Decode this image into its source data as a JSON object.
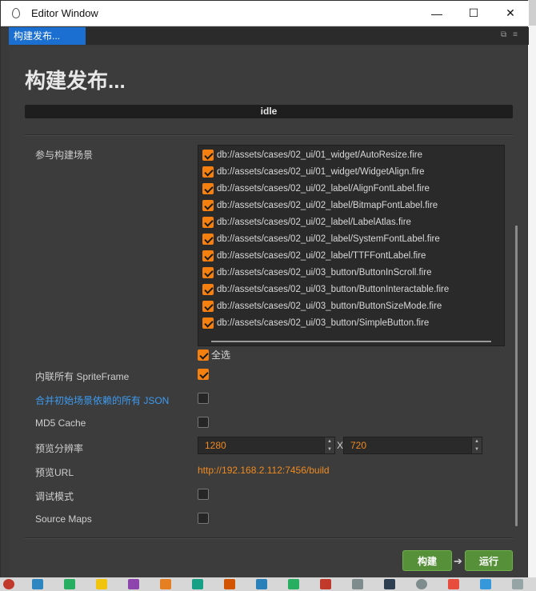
{
  "window": {
    "title": "Editor Window",
    "minimize": "—",
    "maximize": "☐",
    "close": "✕"
  },
  "tab": {
    "label": "构建发布..."
  },
  "heading": "构建发布...",
  "status": "idle",
  "scenes_label": "参与构建场景",
  "scenes": [
    {
      "path": "db://assets/cases/02_ui/01_widget/AutoResize.fire",
      "checked": true
    },
    {
      "path": "db://assets/cases/02_ui/01_widget/WidgetAlign.fire",
      "checked": true
    },
    {
      "path": "db://assets/cases/02_ui/02_label/AlignFontLabel.fire",
      "checked": true
    },
    {
      "path": "db://assets/cases/02_ui/02_label/BitmapFontLabel.fire",
      "checked": true
    },
    {
      "path": "db://assets/cases/02_ui/02_label/LabelAtlas.fire",
      "checked": true
    },
    {
      "path": "db://assets/cases/02_ui/02_label/SystemFontLabel.fire",
      "checked": true
    },
    {
      "path": "db://assets/cases/02_ui/02_label/TTFFontLabel.fire",
      "checked": true
    },
    {
      "path": "db://assets/cases/02_ui/03_button/ButtonInScroll.fire",
      "checked": true
    },
    {
      "path": "db://assets/cases/02_ui/03_button/ButtonInteractable.fire",
      "checked": true
    },
    {
      "path": "db://assets/cases/02_ui/03_button/ButtonSizeMode.fire",
      "checked": true
    },
    {
      "path": "db://assets/cases/02_ui/03_button/SimpleButton.fire",
      "checked": true
    }
  ],
  "select_all": {
    "label": "全选",
    "checked": true
  },
  "options": {
    "inline_spriteframe": {
      "label": "内联所有 SpriteFrame",
      "checked": true
    },
    "merge_json": {
      "label": "合并初始场景依赖的所有 JSON",
      "checked": false
    },
    "md5_cache": {
      "label": "MD5 Cache",
      "checked": false
    },
    "preview_resolution": {
      "label": "预览分辨率",
      "width": "1280",
      "height": "720",
      "separator": "X"
    },
    "preview_url": {
      "label": "预览URL",
      "value": "http://192.168.2.112:7456/build"
    },
    "debug_mode": {
      "label": "调试模式",
      "checked": false
    },
    "source_maps": {
      "label": "Source Maps",
      "checked": false
    }
  },
  "buttons": {
    "build": "构建",
    "run": "运行",
    "arrow": "➔"
  },
  "colors": {
    "accent": "#f57f0f",
    "tab_blue": "#1b6fd1",
    "button_green": "#56913a",
    "link_blue": "#3d9bf0"
  }
}
